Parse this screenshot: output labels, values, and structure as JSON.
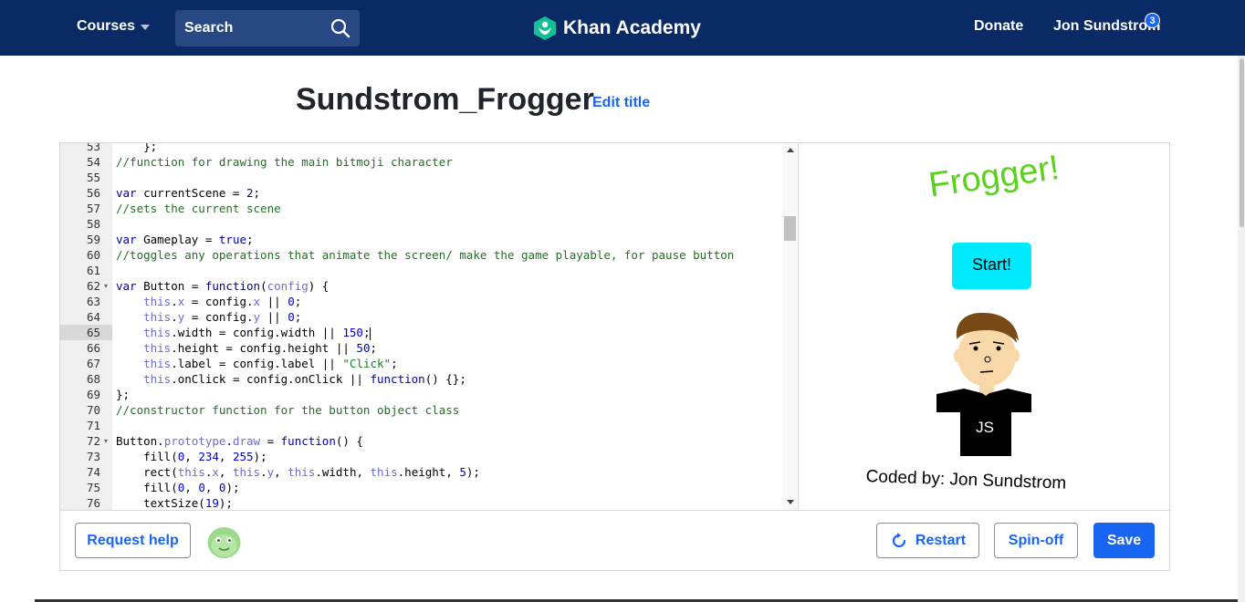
{
  "nav": {
    "courses_label": "Courses",
    "search_label": "Search",
    "brand_name": "Khan Academy",
    "donate_label": "Donate",
    "user_name": "Jon Sundstrom",
    "notification_count": "3",
    "bg_color": "#0a2a66"
  },
  "program": {
    "title": "Sundstrom_Frogger",
    "edit_title_label": "Edit title"
  },
  "editor": {
    "active_line": 65,
    "lines": [
      {
        "num": "53",
        "html": "    };"
      },
      {
        "num": "54",
        "html": "<span class=\"c\">//function for drawing the main bitmoji character</span>"
      },
      {
        "num": "55",
        "html": ""
      },
      {
        "num": "56",
        "html": "<span class=\"k\">var</span> currentScene = <span class=\"n\">2</span>;"
      },
      {
        "num": "57",
        "html": "<span class=\"c\">//sets the current scene</span>"
      },
      {
        "num": "58",
        "html": ""
      },
      {
        "num": "59",
        "html": "<span class=\"k\">var</span> Gameplay = <span class=\"k\">true</span>;"
      },
      {
        "num": "60",
        "html": "<span class=\"c\">//toggles any operations that animate the screen/ make the game playable, for pause button</span>"
      },
      {
        "num": "61",
        "html": ""
      },
      {
        "num": "62",
        "fold": true,
        "html": "<span class=\"k\">var</span> Button = <span class=\"k\">function</span>(<span class=\"t\">config</span>) {"
      },
      {
        "num": "63",
        "html": "    <span class=\"t\">this</span>.<span class=\"t\">x</span> = config.<span class=\"t\">x</span> || <span class=\"n\">0</span>;"
      },
      {
        "num": "64",
        "html": "    <span class=\"t\">this</span>.<span class=\"t\">y</span> = config.<span class=\"t\">y</span> || <span class=\"n\">0</span>;"
      },
      {
        "num": "65",
        "html": "    <span class=\"t\">this</span>.width = config.width || <span class=\"n\">150</span>;<span class=\"cursor\"></span>"
      },
      {
        "num": "66",
        "html": "    <span class=\"t\">this</span>.height = config.height || <span class=\"n\">50</span>;"
      },
      {
        "num": "67",
        "html": "    <span class=\"t\">this</span>.label = config.label || <span class=\"s2\">\"Click\"</span>;"
      },
      {
        "num": "68",
        "html": "    <span class=\"t\">this</span>.onClick = config.onClick || <span class=\"k\">function</span>() {};"
      },
      {
        "num": "69",
        "html": "};"
      },
      {
        "num": "70",
        "html": "<span class=\"c\">//constructor function for the button object class</span>"
      },
      {
        "num": "71",
        "html": ""
      },
      {
        "num": "72",
        "fold": true,
        "html": "Button.<span class=\"t\">prototype</span>.<span class=\"t\">draw</span> = <span class=\"k\">function</span>() {"
      },
      {
        "num": "73",
        "html": "    fill(<span class=\"n\">0</span>, <span class=\"n\">234</span>, <span class=\"n\">255</span>);"
      },
      {
        "num": "74",
        "html": "    rect(<span class=\"t\">this</span>.<span class=\"t\">x</span>, <span class=\"t\">this</span>.<span class=\"t\">y</span>, <span class=\"t\">this</span>.width, <span class=\"t\">this</span>.height, <span class=\"n\">5</span>);"
      },
      {
        "num": "75",
        "html": "    fill(<span class=\"n\">0</span>, <span class=\"n\">0</span>, <span class=\"n\">0</span>);"
      },
      {
        "num": "76",
        "html": "    textSize(<span class=\"n\">19</span>);"
      }
    ]
  },
  "canvas": {
    "game_title": "Frogger!",
    "start_label": "Start!",
    "shirt_text": "JS",
    "coded_by": "Coded by: Jon Sundstrom",
    "title_color": "#5ad21d",
    "button_color": "#00eaff"
  },
  "footer": {
    "request_help_label": "Request help",
    "restart_label": "Restart",
    "spinoff_label": "Spin-off",
    "save_label": "Save"
  }
}
